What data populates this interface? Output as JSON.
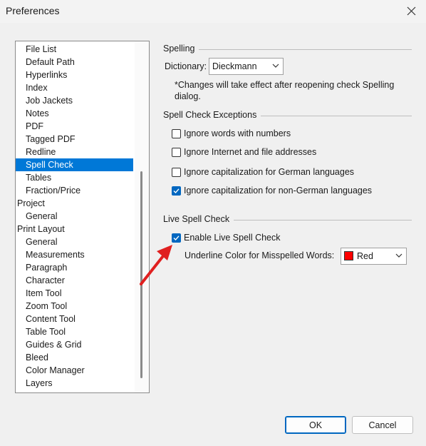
{
  "window": {
    "title": "Preferences"
  },
  "tree": {
    "items": [
      {
        "label": "File List",
        "level": 1
      },
      {
        "label": "Default Path",
        "level": 1
      },
      {
        "label": "Hyperlinks",
        "level": 1
      },
      {
        "label": "Index",
        "level": 1
      },
      {
        "label": "Job Jackets",
        "level": 1
      },
      {
        "label": "Notes",
        "level": 1
      },
      {
        "label": "PDF",
        "level": 1
      },
      {
        "label": "Tagged PDF",
        "level": 1
      },
      {
        "label": "Redline",
        "level": 1
      },
      {
        "label": "Spell Check",
        "level": 1,
        "selected": true
      },
      {
        "label": "Tables",
        "level": 1
      },
      {
        "label": "Fraction/Price",
        "level": 1
      },
      {
        "label": "Project",
        "level": 0
      },
      {
        "label": "General",
        "level": 1
      },
      {
        "label": "Print Layout",
        "level": 0
      },
      {
        "label": "General",
        "level": 1
      },
      {
        "label": "Measurements",
        "level": 1
      },
      {
        "label": "Paragraph",
        "level": 1
      },
      {
        "label": "Character",
        "level": 1
      },
      {
        "label": "Item Tool",
        "level": 1
      },
      {
        "label": "Zoom Tool",
        "level": 1
      },
      {
        "label": "Content Tool",
        "level": 1
      },
      {
        "label": "Table Tool",
        "level": 1
      },
      {
        "label": "Guides & Grid",
        "level": 1
      },
      {
        "label": "Bleed",
        "level": 1
      },
      {
        "label": "Color Manager",
        "level": 1
      },
      {
        "label": "Layers",
        "level": 1
      }
    ]
  },
  "spelling": {
    "group_title": "Spelling",
    "dictionary_label": "Dictionary:",
    "dictionary_value": "Dieckmann",
    "note": "*Changes will take effect after reopening check Spelling dialog."
  },
  "exceptions": {
    "group_title": "Spell Check Exceptions",
    "options": [
      {
        "label": "Ignore words with numbers",
        "checked": false
      },
      {
        "label": "Ignore Internet and file addresses",
        "checked": false
      },
      {
        "label": "Ignore capitalization for German languages",
        "checked": false
      },
      {
        "label": "Ignore capitalization for non-German languages",
        "checked": true
      }
    ]
  },
  "live": {
    "group_title": "Live Spell Check",
    "enable_label": "Enable Live Spell Check",
    "enable_checked": true,
    "underline_label": "Underline Color for Misspelled Words:",
    "underline_value": "Red",
    "underline_color": "#ff0000"
  },
  "buttons": {
    "ok": "OK",
    "cancel": "Cancel"
  },
  "colors": {
    "accent": "#0078d7",
    "checkbox": "#0067c0",
    "annotation_arrow": "#e02020"
  }
}
